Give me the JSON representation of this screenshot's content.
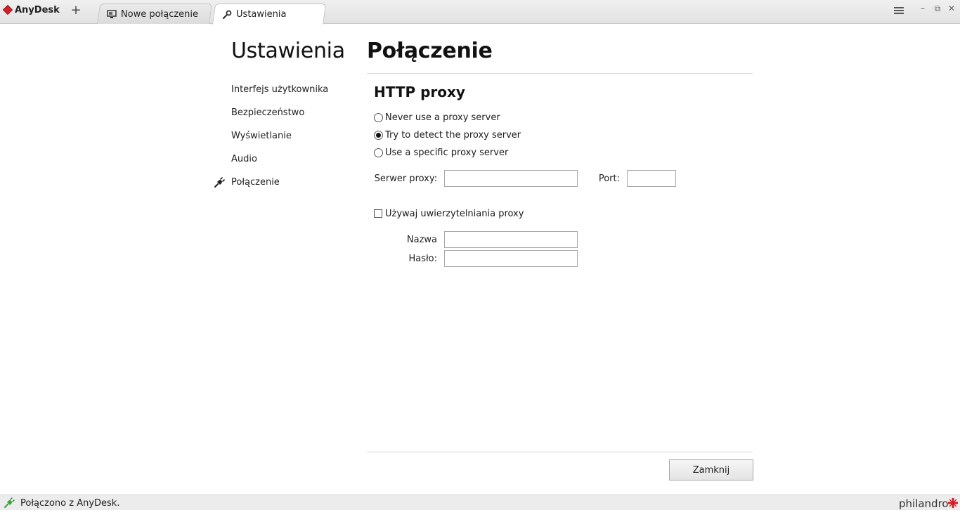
{
  "app": {
    "brand": "AnyDesk",
    "plus": "+",
    "colors": {
      "brand_red": "#d51f26",
      "status_green": "#3aa23a"
    }
  },
  "tabs": [
    {
      "label": "Nowe połączenie",
      "icon": "monitor-icon"
    },
    {
      "label": "Ustawienia",
      "icon": "wrench-icon"
    }
  ],
  "window_controls": {
    "minimize": "–",
    "maximize": "⧉",
    "close": "✕"
  },
  "sidebar": {
    "title": "Ustawienia",
    "items": [
      {
        "label": "Interfejs użytkownika"
      },
      {
        "label": "Bezpieczeństwo"
      },
      {
        "label": "Wyświetlanie"
      },
      {
        "label": "Audio"
      },
      {
        "label": "Połączenie",
        "active": true
      }
    ]
  },
  "content": {
    "title": "Połączenie",
    "section_title": "HTTP proxy",
    "radios": [
      {
        "label": "Never use a proxy server",
        "checked": false
      },
      {
        "label": "Try to detect the proxy server",
        "checked": true
      },
      {
        "label": "Use a specific proxy server",
        "checked": false
      }
    ],
    "proxy_server_label": "Serwer proxy:",
    "proxy_server_value": "",
    "port_label": "Port:",
    "port_value": "",
    "auth_checkbox_label": "Używaj uwierzytelniania proxy",
    "auth_checked": false,
    "name_label": "Nazwa",
    "name_value": "",
    "password_label": "Hasło:",
    "password_value": "",
    "close_button": "Zamknij"
  },
  "statusbar": {
    "text": "Połączono z AnyDesk.",
    "vendor": "philandro"
  }
}
